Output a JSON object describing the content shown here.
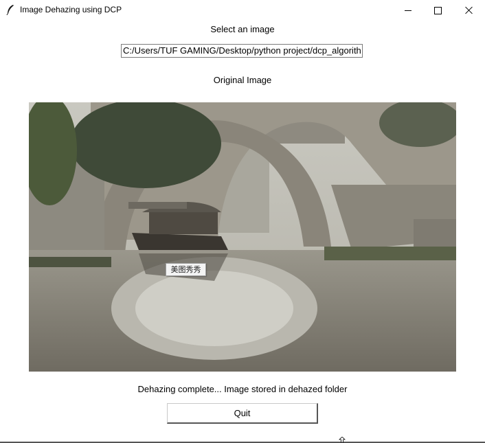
{
  "window": {
    "title": "Image Dehazing using DCP",
    "icon": "feather-icon"
  },
  "select_label": "Select an image",
  "path_entry": {
    "value": "C:/Users/TUF GAMING/Desktop/python project/dcp_algorith"
  },
  "original_label": "Original Image",
  "image": {
    "overlay_tag": "美图秀秀"
  },
  "status": "Dehazing complete... Image stored in dehazed folder",
  "quit_button": "Quit",
  "colors": {
    "background": "#ffffff",
    "haze": "#b5b4ab",
    "water": "#8f8b80"
  }
}
